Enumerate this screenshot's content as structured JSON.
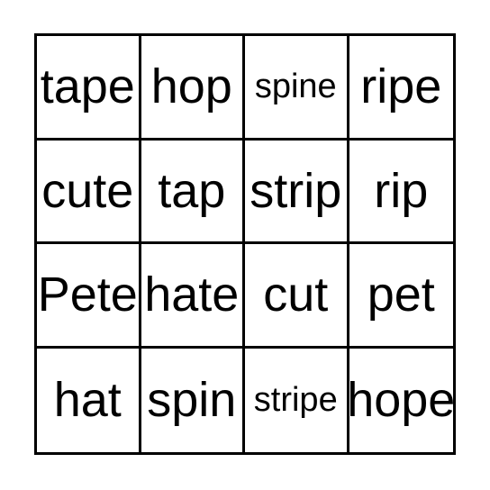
{
  "card": {
    "type": "word-bingo-grid",
    "rows": 4,
    "columns": 4,
    "background_color": "#ffffff",
    "border_color": "#000000",
    "text_color": "#000000",
    "cells": [
      [
        {
          "word": "tape",
          "shrunk": false
        },
        {
          "word": "hop",
          "shrunk": false
        },
        {
          "word": "spine",
          "shrunk": true
        },
        {
          "word": "ripe",
          "shrunk": false
        }
      ],
      [
        {
          "word": "cute",
          "shrunk": false
        },
        {
          "word": "tap",
          "shrunk": false
        },
        {
          "word": "strip",
          "shrunk": false
        },
        {
          "word": "rip",
          "shrunk": false
        }
      ],
      [
        {
          "word": "Pete",
          "shrunk": false
        },
        {
          "word": "hate",
          "shrunk": false
        },
        {
          "word": "cut",
          "shrunk": false
        },
        {
          "word": "pet",
          "shrunk": false
        }
      ],
      [
        {
          "word": "hat",
          "shrunk": false
        },
        {
          "word": "spin",
          "shrunk": false
        },
        {
          "word": "stripe",
          "shrunk": true
        },
        {
          "word": "hope",
          "shrunk": false
        }
      ]
    ]
  }
}
